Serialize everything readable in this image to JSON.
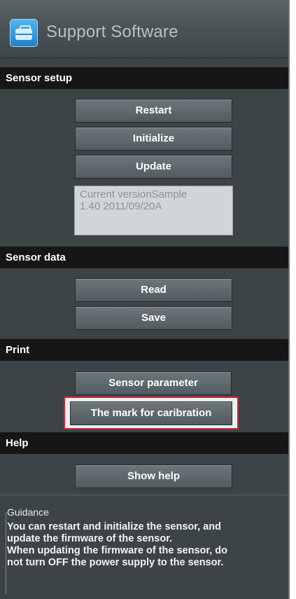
{
  "window": {
    "title": "Support Software",
    "icon": "toolbox-icon"
  },
  "sections": {
    "sensor_setup": {
      "label": "Sensor setup",
      "buttons": {
        "restart": "Restart",
        "initialize": "Initialize",
        "update": "Update"
      },
      "version_line1": "Current versionSample",
      "version_line2": "1.40 2011/09/20A"
    },
    "sensor_data": {
      "label": "Sensor data",
      "buttons": {
        "read": "Read",
        "save": "Save"
      }
    },
    "print": {
      "label": "Print",
      "buttons": {
        "sensor_parameter": "Sensor parameter",
        "calibration_mark": "The mark for caribration"
      }
    },
    "help": {
      "label": "Help",
      "buttons": {
        "show_help": "Show help"
      }
    }
  },
  "guidance": {
    "title": "Guidance",
    "lines": [
      "You can restart and initialize the sensor, and",
      "update the firmware of the sensor.",
      "When updating the firmware of the sensor, do",
      "not turn OFF the power supply to the sensor."
    ]
  },
  "colors": {
    "panel_bg": "#3d4448",
    "section_header_bg": "#161616",
    "highlight_border": "#c8283a",
    "icon_blue": "#1f7fc8"
  }
}
